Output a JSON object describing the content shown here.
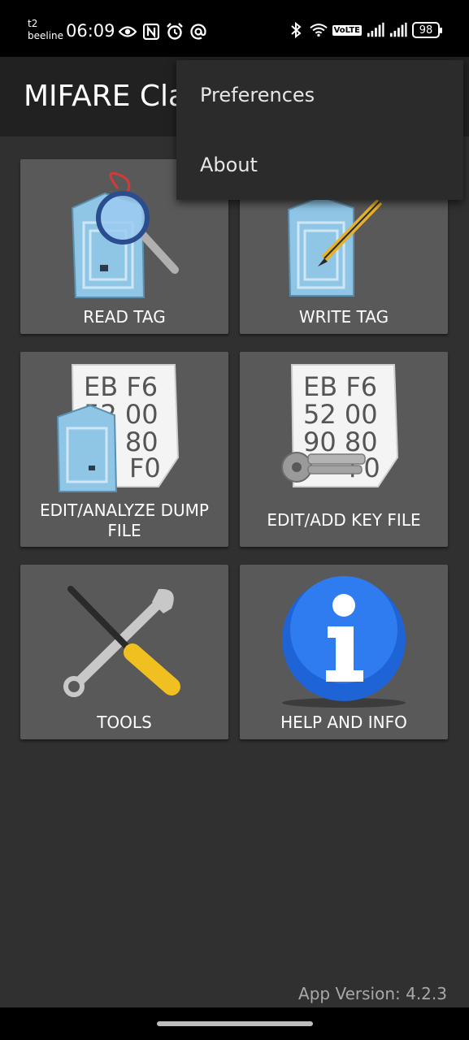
{
  "status_bar": {
    "carrier_top": "t2",
    "carrier_bottom": "beeline",
    "time": "06:09",
    "volte": "VoLTE",
    "battery": "98"
  },
  "app_bar": {
    "title": "MIFARE Classic Tool"
  },
  "menu": {
    "items": [
      "Preferences",
      "About"
    ]
  },
  "tiles": [
    {
      "label": "READ TAG",
      "icon": "read-tag-icon"
    },
    {
      "label": "WRITE TAG",
      "icon": "write-tag-icon"
    },
    {
      "label_line1": "EDIT/ANALYZE DUMP",
      "label_line2": "FILE",
      "icon": "dump-file-icon"
    },
    {
      "label": "EDIT/ADD KEY FILE",
      "icon": "key-file-icon"
    },
    {
      "label": "TOOLS",
      "icon": "tools-icon"
    },
    {
      "label": "HELP AND INFO",
      "icon": "info-icon"
    }
  ],
  "dump_icon_text": [
    "EB F6",
    "52 00",
    "90 80",
    "F0"
  ],
  "footer": {
    "version": "App Version: 4.2.3"
  }
}
